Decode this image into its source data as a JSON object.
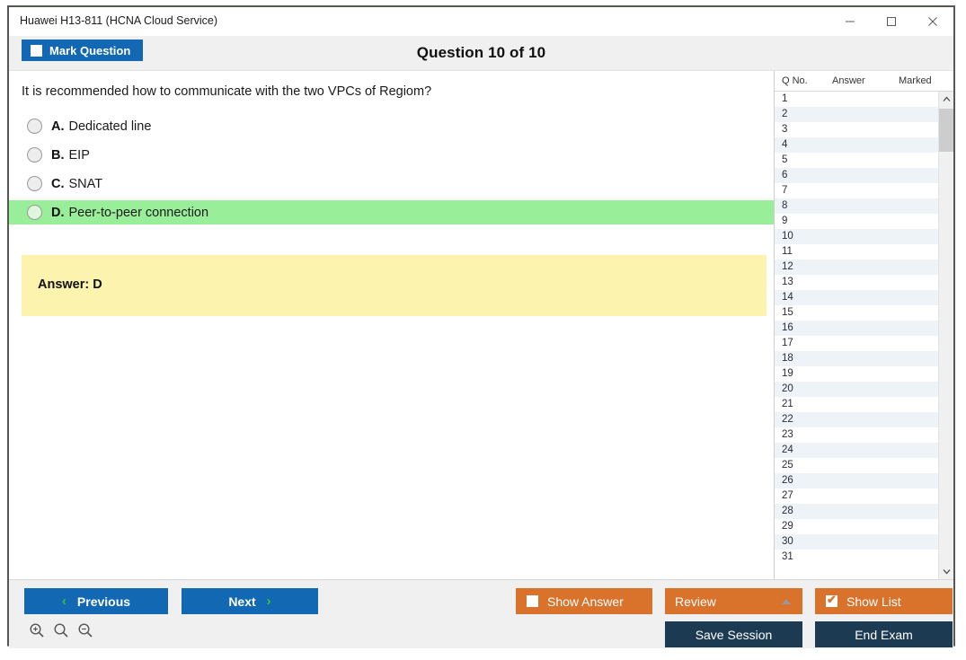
{
  "window": {
    "title": "Huawei H13-811 (HCNA Cloud Service)",
    "minimize_label": "–",
    "maximize_label": "□",
    "close_label": "✕"
  },
  "header": {
    "mark_question_label": "Mark Question",
    "question_counter": "Question 10 of 10"
  },
  "question": {
    "text": "It is recommended how to communicate with the two VPCs of Regiom?",
    "options": [
      {
        "letter": "A.",
        "text": "Dedicated line",
        "selected": false
      },
      {
        "letter": "B.",
        "text": "EIP",
        "selected": false
      },
      {
        "letter": "C.",
        "text": "SNAT",
        "selected": false
      },
      {
        "letter": "D.",
        "text": "Peer-to-peer connection",
        "selected": true
      }
    ],
    "answer_label": "Answer: D"
  },
  "list_panel": {
    "columns": [
      "Q No.",
      "Answer",
      "Marked"
    ],
    "rows": [
      {
        "no": "1",
        "answer": "",
        "marked": ""
      },
      {
        "no": "2",
        "answer": "",
        "marked": ""
      },
      {
        "no": "3",
        "answer": "",
        "marked": ""
      },
      {
        "no": "4",
        "answer": "",
        "marked": ""
      },
      {
        "no": "5",
        "answer": "",
        "marked": ""
      },
      {
        "no": "6",
        "answer": "",
        "marked": ""
      },
      {
        "no": "7",
        "answer": "",
        "marked": ""
      },
      {
        "no": "8",
        "answer": "",
        "marked": ""
      },
      {
        "no": "9",
        "answer": "",
        "marked": ""
      },
      {
        "no": "10",
        "answer": "",
        "marked": ""
      },
      {
        "no": "11",
        "answer": "",
        "marked": ""
      },
      {
        "no": "12",
        "answer": "",
        "marked": ""
      },
      {
        "no": "13",
        "answer": "",
        "marked": ""
      },
      {
        "no": "14",
        "answer": "",
        "marked": ""
      },
      {
        "no": "15",
        "answer": "",
        "marked": ""
      },
      {
        "no": "16",
        "answer": "",
        "marked": ""
      },
      {
        "no": "17",
        "answer": "",
        "marked": ""
      },
      {
        "no": "18",
        "answer": "",
        "marked": ""
      },
      {
        "no": "19",
        "answer": "",
        "marked": ""
      },
      {
        "no": "20",
        "answer": "",
        "marked": ""
      },
      {
        "no": "21",
        "answer": "",
        "marked": ""
      },
      {
        "no": "22",
        "answer": "",
        "marked": ""
      },
      {
        "no": "23",
        "answer": "",
        "marked": ""
      },
      {
        "no": "24",
        "answer": "",
        "marked": ""
      },
      {
        "no": "25",
        "answer": "",
        "marked": ""
      },
      {
        "no": "26",
        "answer": "",
        "marked": ""
      },
      {
        "no": "27",
        "answer": "",
        "marked": ""
      },
      {
        "no": "28",
        "answer": "",
        "marked": ""
      },
      {
        "no": "29",
        "answer": "",
        "marked": ""
      },
      {
        "no": "30",
        "answer": "",
        "marked": ""
      },
      {
        "no": "31",
        "answer": "",
        "marked": ""
      }
    ]
  },
  "footer": {
    "previous_label": "Previous",
    "next_label": "Next",
    "previous_chevron": "‹",
    "next_chevron": "›",
    "show_answer_label": "Show Answer",
    "show_answer_checked": false,
    "review_label": "Review",
    "show_list_label": "Show List",
    "show_list_checked": true,
    "show_list_check_glyph": "✔",
    "save_session_label": "Save Session",
    "end_exam_label": "End Exam"
  },
  "colors": {
    "blue": "#1268b3",
    "orange": "#d9722b",
    "navy": "#1c3a52",
    "selected_option": "#99ee99",
    "answer_box": "#fbf3ae",
    "green_chevron": "#36c832"
  }
}
